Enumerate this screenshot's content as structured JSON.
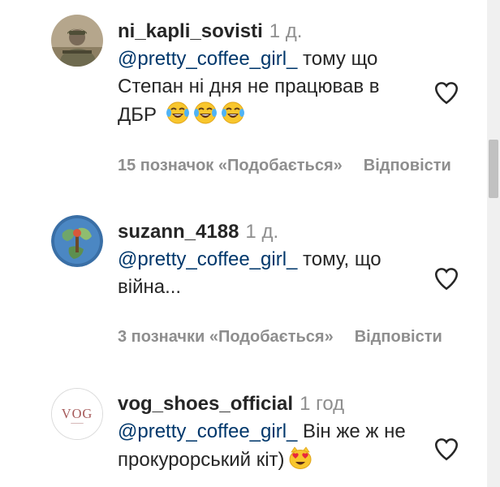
{
  "comments": [
    {
      "username": "ni_kapli_sovisti",
      "time": "1 д.",
      "mention": "@pretty_coffee_girl_",
      "text": " тому що Степан ні дня не працював в ДБР",
      "emojis": [
        "tears-of-joy-emoji",
        "tears-of-joy-emoji",
        "tears-of-joy-emoji"
      ],
      "likes": "15 позначок «Подобається»",
      "reply": "Відповісти",
      "avatar_icon": "soldier-photo-avatar"
    },
    {
      "username": "suzann_4188",
      "time": "1 д.",
      "mention": "@pretty_coffee_girl_",
      "text": " тому, що війна...",
      "emojis": [],
      "likes": "3 позначки «Подобається»",
      "reply": "Відповісти",
      "avatar_icon": "globe-painting-avatar"
    },
    {
      "username": "vog_shoes_official",
      "time": "1 год",
      "mention": "@pretty_coffee_girl_",
      "text": " Він же ж не прокурорський кіт)",
      "emojis": [
        "heart-eyes-cat-emoji"
      ],
      "likes": "",
      "reply": "",
      "avatar_icon": "vog-logo-avatar",
      "avatar_text": "VOG"
    }
  ],
  "colors": {
    "text": "#262626",
    "secondary": "#8e8e8e",
    "mention": "#00376b"
  }
}
